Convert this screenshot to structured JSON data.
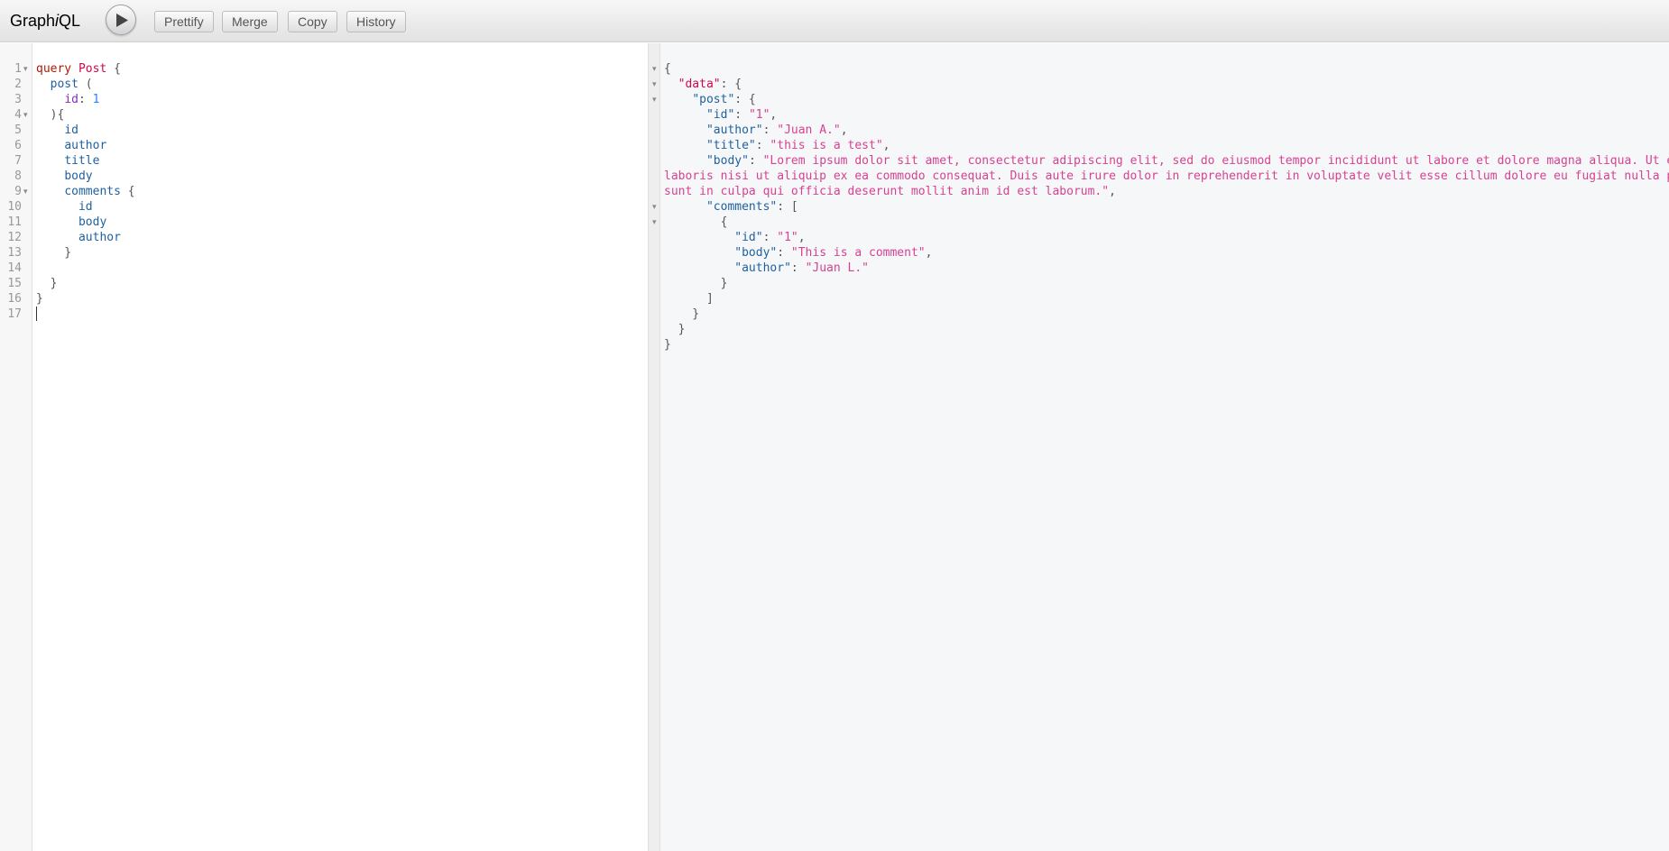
{
  "toolbar": {
    "logo_prefix": "Graph",
    "logo_i": "i",
    "logo_suffix": "QL",
    "run_icon": "play-icon",
    "buttons": [
      "Prettify",
      "Merge",
      "Copy",
      "History"
    ]
  },
  "query_editor": {
    "line_numbers": [
      "1",
      "2",
      "3",
      "4",
      "5",
      "6",
      "7",
      "8",
      "9",
      "10",
      "11",
      "12",
      "13",
      "14",
      "15",
      "16",
      "17"
    ],
    "lines": [
      {
        "segments": [
          {
            "t": "query",
            "c": "kw"
          },
          {
            "t": " ",
            "c": "punc"
          },
          {
            "t": "Post",
            "c": "def"
          },
          {
            "t": " {",
            "c": "punc"
          }
        ]
      },
      {
        "segments": [
          {
            "t": "  ",
            "c": "punc"
          },
          {
            "t": "post",
            "c": "prop"
          },
          {
            "t": " (",
            "c": "punc"
          }
        ]
      },
      {
        "segments": [
          {
            "t": "    ",
            "c": "punc"
          },
          {
            "t": "id",
            "c": "attr"
          },
          {
            "t": ": ",
            "c": "punc"
          },
          {
            "t": "1",
            "c": "num"
          }
        ]
      },
      {
        "segments": [
          {
            "t": "  ){",
            "c": "punc"
          }
        ]
      },
      {
        "segments": [
          {
            "t": "    ",
            "c": "punc"
          },
          {
            "t": "id",
            "c": "prop"
          }
        ]
      },
      {
        "segments": [
          {
            "t": "    ",
            "c": "punc"
          },
          {
            "t": "author",
            "c": "prop"
          }
        ]
      },
      {
        "segments": [
          {
            "t": "    ",
            "c": "punc"
          },
          {
            "t": "title",
            "c": "prop"
          }
        ]
      },
      {
        "segments": [
          {
            "t": "    ",
            "c": "punc"
          },
          {
            "t": "body",
            "c": "prop"
          }
        ]
      },
      {
        "segments": [
          {
            "t": "    ",
            "c": "punc"
          },
          {
            "t": "comments",
            "c": "prop"
          },
          {
            "t": " {",
            "c": "punc"
          }
        ]
      },
      {
        "segments": [
          {
            "t": "      ",
            "c": "punc"
          },
          {
            "t": "id",
            "c": "prop"
          }
        ]
      },
      {
        "segments": [
          {
            "t": "      ",
            "c": "punc"
          },
          {
            "t": "body",
            "c": "prop"
          }
        ]
      },
      {
        "segments": [
          {
            "t": "      ",
            "c": "punc"
          },
          {
            "t": "author",
            "c": "prop"
          }
        ]
      },
      {
        "segments": [
          {
            "t": "    }",
            "c": "punc"
          }
        ]
      },
      {
        "segments": []
      },
      {
        "segments": [
          {
            "t": "  }",
            "c": "punc"
          }
        ]
      },
      {
        "segments": [
          {
            "t": "}",
            "c": "punc"
          }
        ]
      },
      {
        "segments": []
      }
    ],
    "fold_lines": [
      1,
      4,
      9
    ]
  },
  "result": {
    "lines": [
      {
        "segments": [
          {
            "t": "{",
            "c": "punc"
          }
        ]
      },
      {
        "segments": [
          {
            "t": "  ",
            "c": "punc"
          },
          {
            "t": "\"data\"",
            "c": "jkey-data"
          },
          {
            "t": ": {",
            "c": "punc"
          }
        ]
      },
      {
        "segments": [
          {
            "t": "    ",
            "c": "punc"
          },
          {
            "t": "\"post\"",
            "c": "jkey"
          },
          {
            "t": ": {",
            "c": "punc"
          }
        ]
      },
      {
        "segments": [
          {
            "t": "      ",
            "c": "punc"
          },
          {
            "t": "\"id\"",
            "c": "jkey"
          },
          {
            "t": ": ",
            "c": "punc"
          },
          {
            "t": "\"1\"",
            "c": "jstr"
          },
          {
            "t": ",",
            "c": "punc"
          }
        ]
      },
      {
        "segments": [
          {
            "t": "      ",
            "c": "punc"
          },
          {
            "t": "\"author\"",
            "c": "jkey"
          },
          {
            "t": ": ",
            "c": "punc"
          },
          {
            "t": "\"Juan A.\"",
            "c": "jstr"
          },
          {
            "t": ",",
            "c": "punc"
          }
        ]
      },
      {
        "segments": [
          {
            "t": "      ",
            "c": "punc"
          },
          {
            "t": "\"title\"",
            "c": "jkey"
          },
          {
            "t": ": ",
            "c": "punc"
          },
          {
            "t": "\"this is a test\"",
            "c": "jstr"
          },
          {
            "t": ",",
            "c": "punc"
          }
        ]
      },
      {
        "segments": [
          {
            "t": "      ",
            "c": "punc"
          },
          {
            "t": "\"body\"",
            "c": "jkey"
          },
          {
            "t": ": ",
            "c": "punc"
          },
          {
            "t": "\"Lorem ipsum dolor sit amet, consectetur adipiscing elit, sed do eiusmod tempor incididunt ut labore et dolore magna aliqua. Ut e",
            "c": "jstr"
          }
        ]
      },
      {
        "segments": [
          {
            "t": "laboris nisi ut aliquip ex ea commodo consequat. Duis aute irure dolor in reprehenderit in voluptate velit esse cillum dolore eu fugiat nulla p",
            "c": "jstr"
          }
        ]
      },
      {
        "segments": [
          {
            "t": "sunt in culpa qui officia deserunt mollit anim id est laborum.\"",
            "c": "jstr"
          },
          {
            "t": ",",
            "c": "punc"
          }
        ]
      },
      {
        "segments": [
          {
            "t": "      ",
            "c": "punc"
          },
          {
            "t": "\"comments\"",
            "c": "jkey"
          },
          {
            "t": ": [",
            "c": "punc"
          }
        ]
      },
      {
        "segments": [
          {
            "t": "        {",
            "c": "punc"
          }
        ]
      },
      {
        "segments": [
          {
            "t": "          ",
            "c": "punc"
          },
          {
            "t": "\"id\"",
            "c": "jkey"
          },
          {
            "t": ": ",
            "c": "punc"
          },
          {
            "t": "\"1\"",
            "c": "jstr"
          },
          {
            "t": ",",
            "c": "punc"
          }
        ]
      },
      {
        "segments": [
          {
            "t": "          ",
            "c": "punc"
          },
          {
            "t": "\"body\"",
            "c": "jkey"
          },
          {
            "t": ": ",
            "c": "punc"
          },
          {
            "t": "\"This is a comment\"",
            "c": "jstr"
          },
          {
            "t": ",",
            "c": "punc"
          }
        ]
      },
      {
        "segments": [
          {
            "t": "          ",
            "c": "punc"
          },
          {
            "t": "\"author\"",
            "c": "jkey"
          },
          {
            "t": ": ",
            "c": "punc"
          },
          {
            "t": "\"Juan L.\"",
            "c": "jstr"
          }
        ]
      },
      {
        "segments": [
          {
            "t": "        }",
            "c": "punc"
          }
        ]
      },
      {
        "segments": [
          {
            "t": "      ]",
            "c": "punc"
          }
        ]
      },
      {
        "segments": [
          {
            "t": "    }",
            "c": "punc"
          }
        ]
      },
      {
        "segments": [
          {
            "t": "  }",
            "c": "punc"
          }
        ]
      },
      {
        "segments": [
          {
            "t": "}",
            "c": "punc"
          }
        ]
      }
    ],
    "fold_lines": [
      1,
      2,
      3,
      10,
      11
    ]
  },
  "colors": {
    "keyword": "#b11a04",
    "definition": "#d2054e",
    "property": "#1f61a0",
    "attribute": "#8b2bb9",
    "number": "#2882f9",
    "json_string": "#d64292",
    "result_background": "#f6f7f8",
    "gutter_background": "#f7f7f7"
  }
}
